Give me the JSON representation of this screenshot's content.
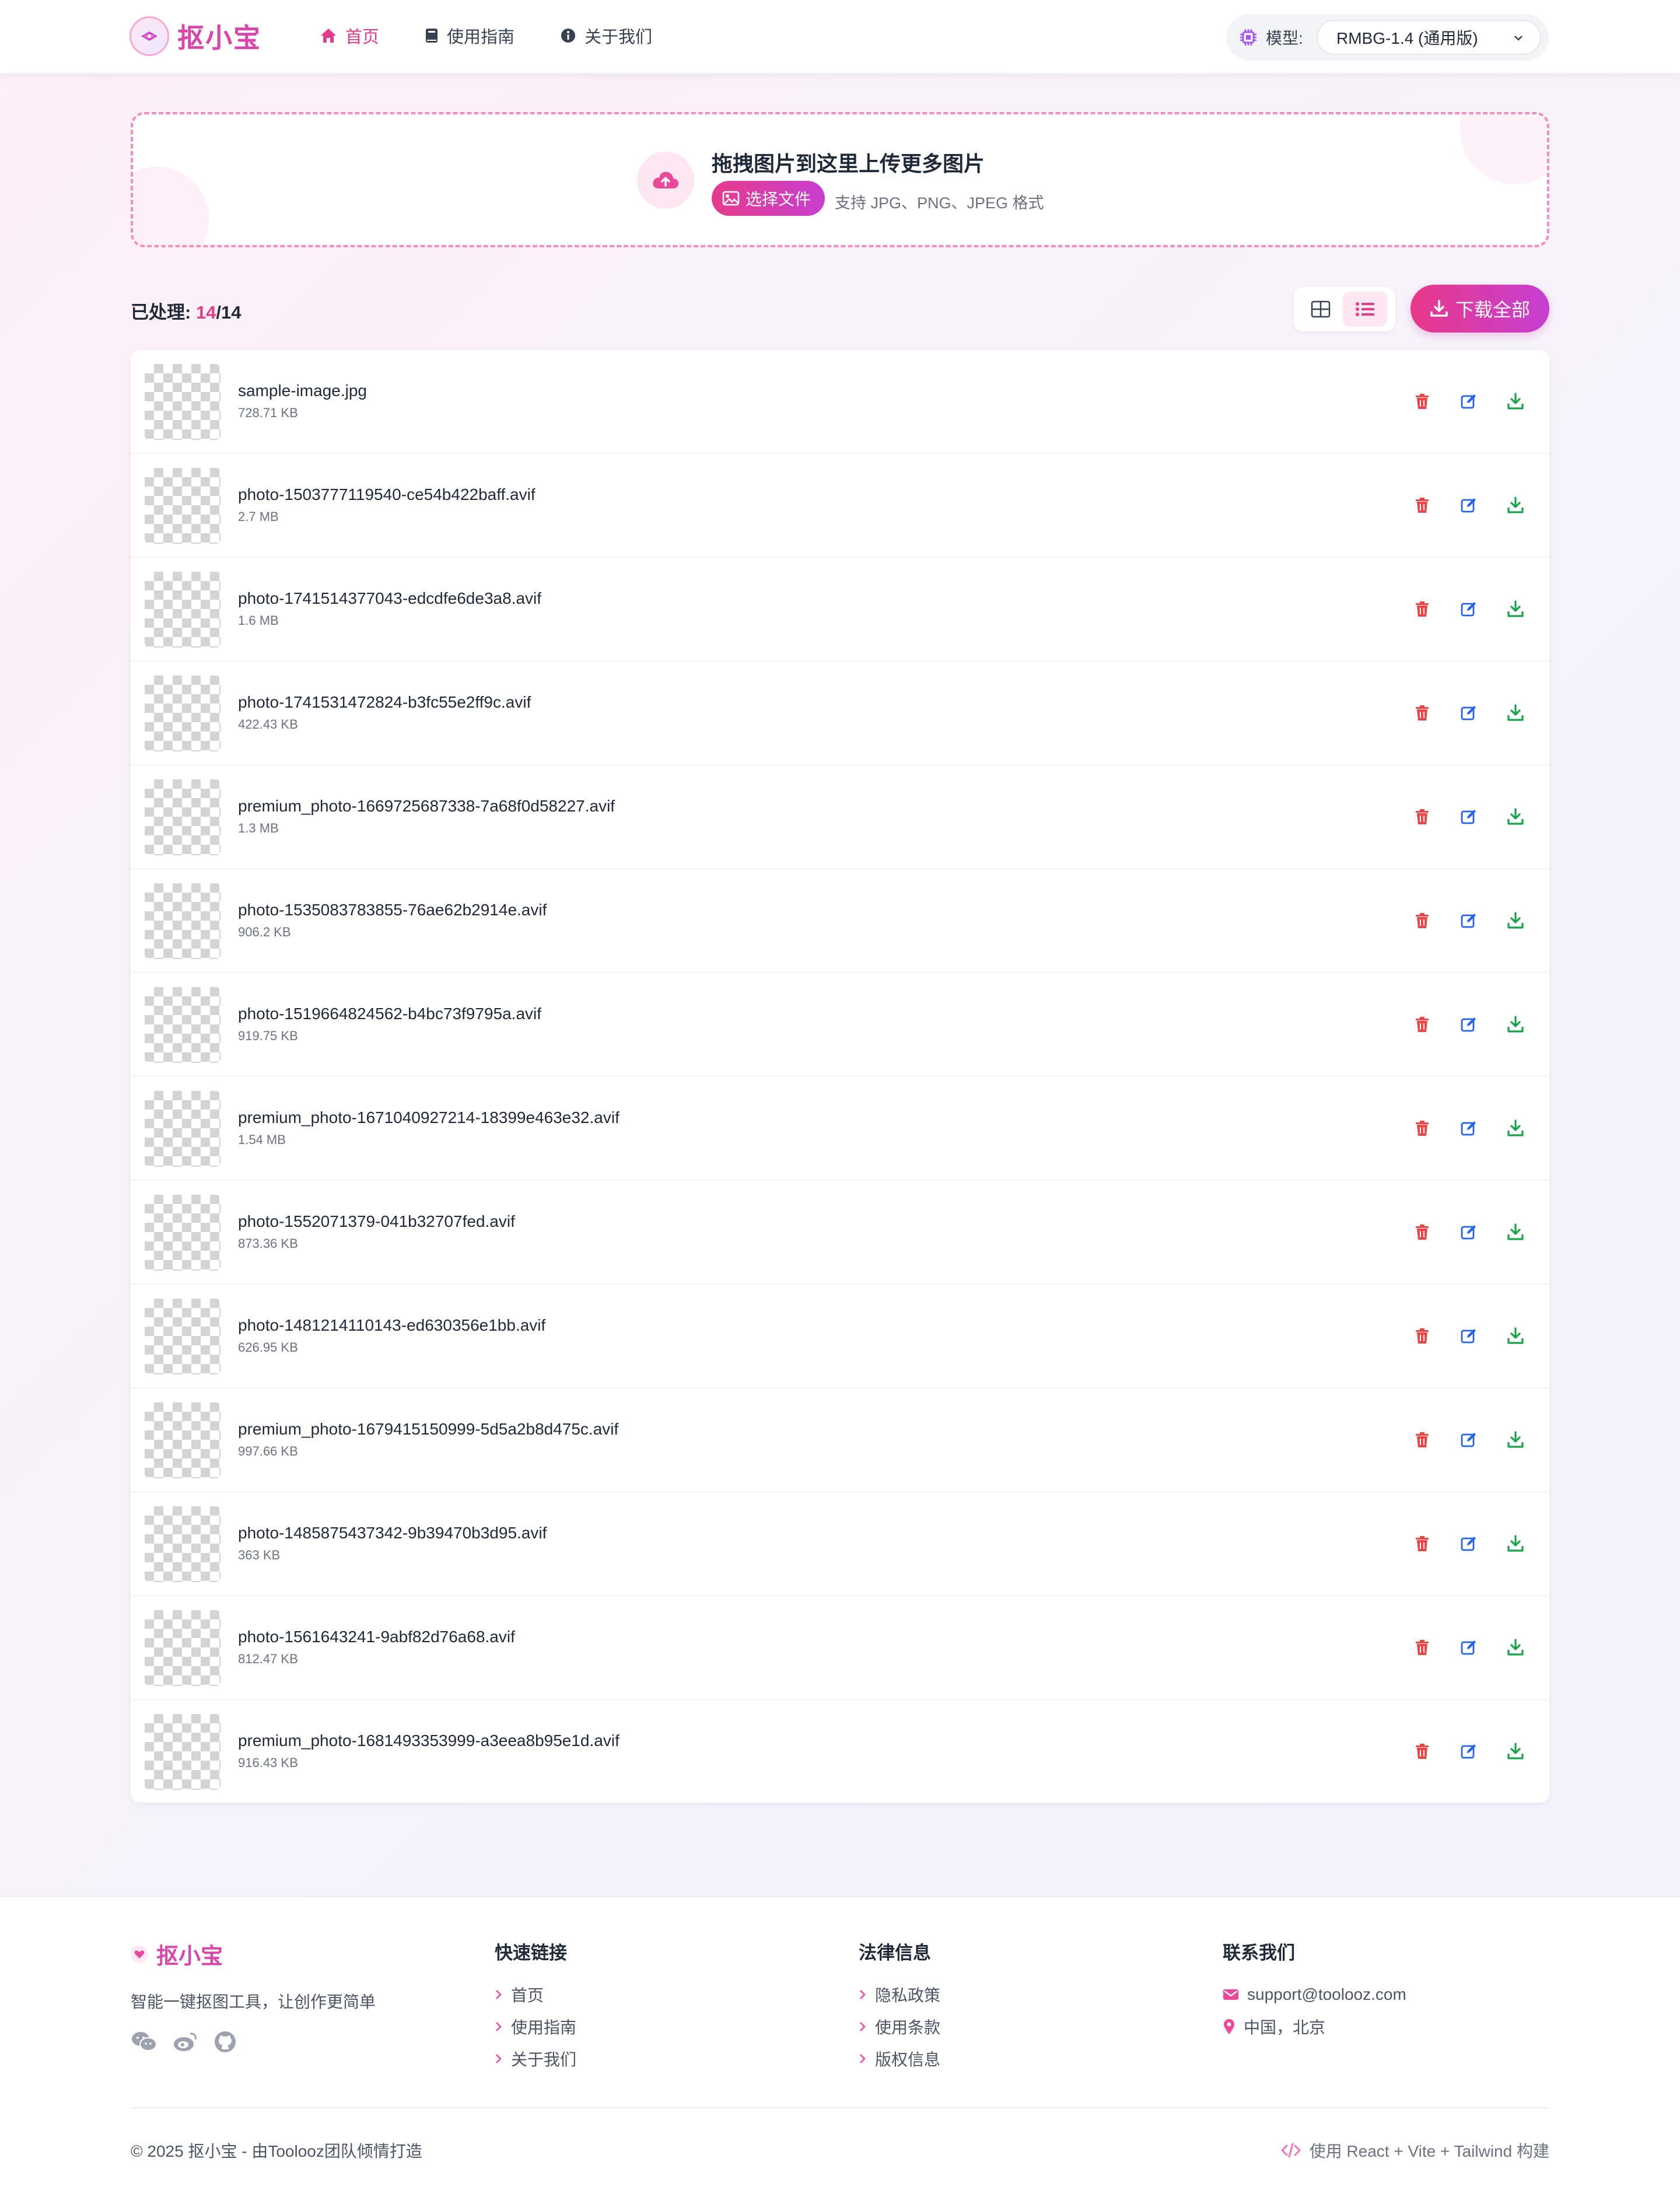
{
  "brand": {
    "name": "抠小宝"
  },
  "nav": [
    {
      "label": "首页",
      "icon": "home-icon",
      "active": true
    },
    {
      "label": "使用指南",
      "icon": "book-icon",
      "active": false
    },
    {
      "label": "关于我们",
      "icon": "info-icon",
      "active": false
    }
  ],
  "model": {
    "label": "模型:",
    "selected": "RMBG-1.4 (通用版)"
  },
  "upload": {
    "title": "拖拽图片到这里上传更多图片",
    "button": "选择文件",
    "hint": "支持 JPG、PNG、JPEG 格式"
  },
  "toolbar": {
    "processed_label": "已处理: ",
    "processed_done": "14",
    "processed_total": "/14",
    "download_all": "下载全部"
  },
  "files": [
    {
      "name": "sample-image.jpg",
      "size": "728.71 KB"
    },
    {
      "name": "photo-1503777119540-ce54b422baff.avif",
      "size": "2.7 MB"
    },
    {
      "name": "photo-1741514377043-edcdfe6de3a8.avif",
      "size": "1.6 MB"
    },
    {
      "name": "photo-1741531472824-b3fc55e2ff9c.avif",
      "size": "422.43 KB"
    },
    {
      "name": "premium_photo-1669725687338-7a68f0d58227.avif",
      "size": "1.3 MB"
    },
    {
      "name": "photo-1535083783855-76ae62b2914e.avif",
      "size": "906.2 KB"
    },
    {
      "name": "photo-1519664824562-b4bc73f9795a.avif",
      "size": "919.75 KB"
    },
    {
      "name": "premium_photo-1671040927214-18399e463e32.avif",
      "size": "1.54 MB"
    },
    {
      "name": "photo-1552071379-041b32707fed.avif",
      "size": "873.36 KB"
    },
    {
      "name": "photo-1481214110143-ed630356e1bb.avif",
      "size": "626.95 KB"
    },
    {
      "name": "premium_photo-1679415150999-5d5a2b8d475c.avif",
      "size": "997.66 KB"
    },
    {
      "name": "photo-1485875437342-9b39470b3d95.avif",
      "size": "363 KB"
    },
    {
      "name": "photo-1561643241-9abf82d76a68.avif",
      "size": "812.47 KB"
    },
    {
      "name": "premium_photo-1681493353999-a3eea8b95e1d.avif",
      "size": "916.43 KB"
    }
  ],
  "footer": {
    "tagline": "智能一键抠图工具，让创作更简单",
    "quick_links": {
      "title": "快速链接",
      "items": [
        "首页",
        "使用指南",
        "关于我们"
      ]
    },
    "legal": {
      "title": "法律信息",
      "items": [
        "隐私政策",
        "使用条款",
        "版权信息"
      ]
    },
    "contact": {
      "title": "联系我们",
      "email": "support@toolooz.com",
      "location": "中国，北京"
    },
    "copyright": "© 2025 抠小宝 - 由Toolooz团队倾情打造",
    "built_with": "使用 React + Vite + Tailwind 构建"
  },
  "colors": {
    "accent": "#e23c8a",
    "accent2": "#c63fd2",
    "delete": "#ef4444",
    "edit": "#2563eb",
    "download": "#16a34a"
  }
}
